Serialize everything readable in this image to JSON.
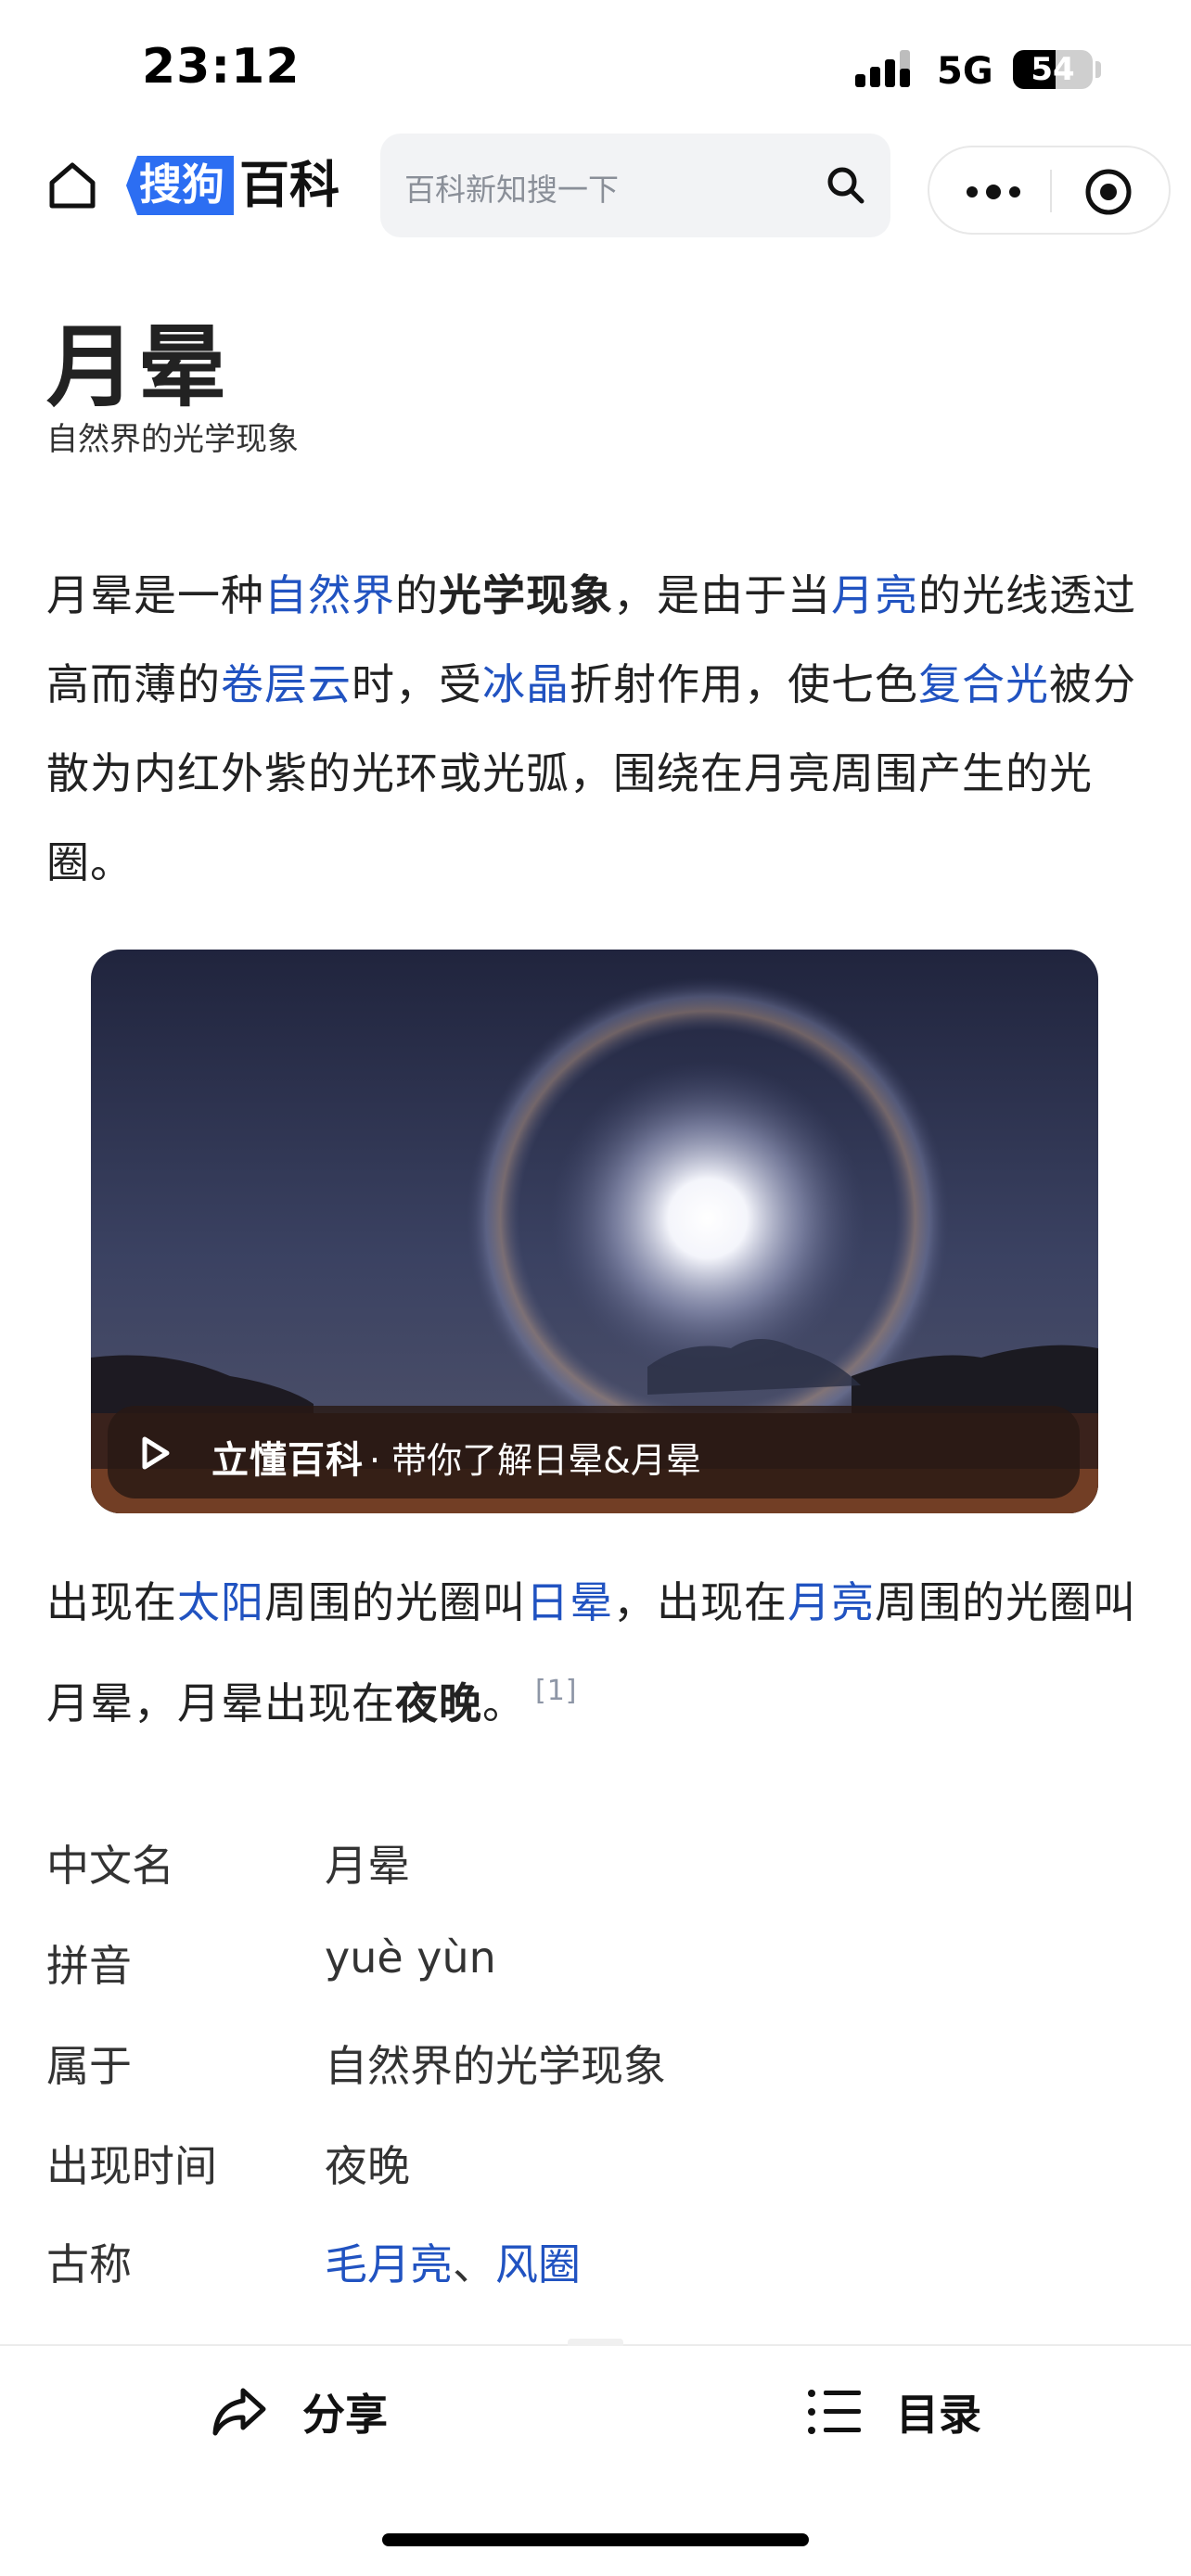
{
  "status_bar": {
    "time": "23:12",
    "network": "5G",
    "battery": "54",
    "battery_level": 0.54
  },
  "nav": {
    "logo_part1": "搜狗",
    "logo_part2": "百科",
    "search_placeholder": "百科新知搜一下"
  },
  "article": {
    "title": "月晕",
    "subtitle": "自然界的光学现象",
    "summary": {
      "t1": "月晕是一种",
      "l1": "自然界",
      "t2": "的",
      "b1": "光学现象",
      "t3": "，是由于当",
      "l2": "月亮",
      "t4": "的光线透过高而薄的",
      "l3": "卷层云",
      "t5": "时，受",
      "l4": "冰晶",
      "t6": "折射作用，使七色",
      "l5": "复合光",
      "t7": "被分散为内红外紫的光环或光弧，围绕在月亮周围产生的光圈。"
    },
    "media": {
      "brand": "立懂百科",
      "caption": "· 带你了解日晕&月晕"
    },
    "para2": {
      "t1": "出现在",
      "l1": "太阳",
      "t2": "周围的光圈叫",
      "l2": "日晕",
      "t3": "，出现在",
      "l3": "月亮",
      "t4": "周围的光圈叫月晕，月晕出现在",
      "b1": "夜晚",
      "t5": "。",
      "cite": "[1]"
    }
  },
  "infobox": [
    {
      "key": "中文名",
      "value": "月晕"
    },
    {
      "key": "拼音",
      "value": "yuè yùn"
    },
    {
      "key": "属于",
      "value": "自然界的光学现象"
    },
    {
      "key": "出现时间",
      "value": "夜晚"
    },
    {
      "key": "古称",
      "links": [
        "毛月亮",
        "风圈"
      ],
      "sep": "、"
    }
  ],
  "bottom_bar": {
    "share": "分享",
    "toc": "目录"
  },
  "colors": {
    "link": "#2153c1",
    "logo_blue": "#2c6ef2"
  }
}
